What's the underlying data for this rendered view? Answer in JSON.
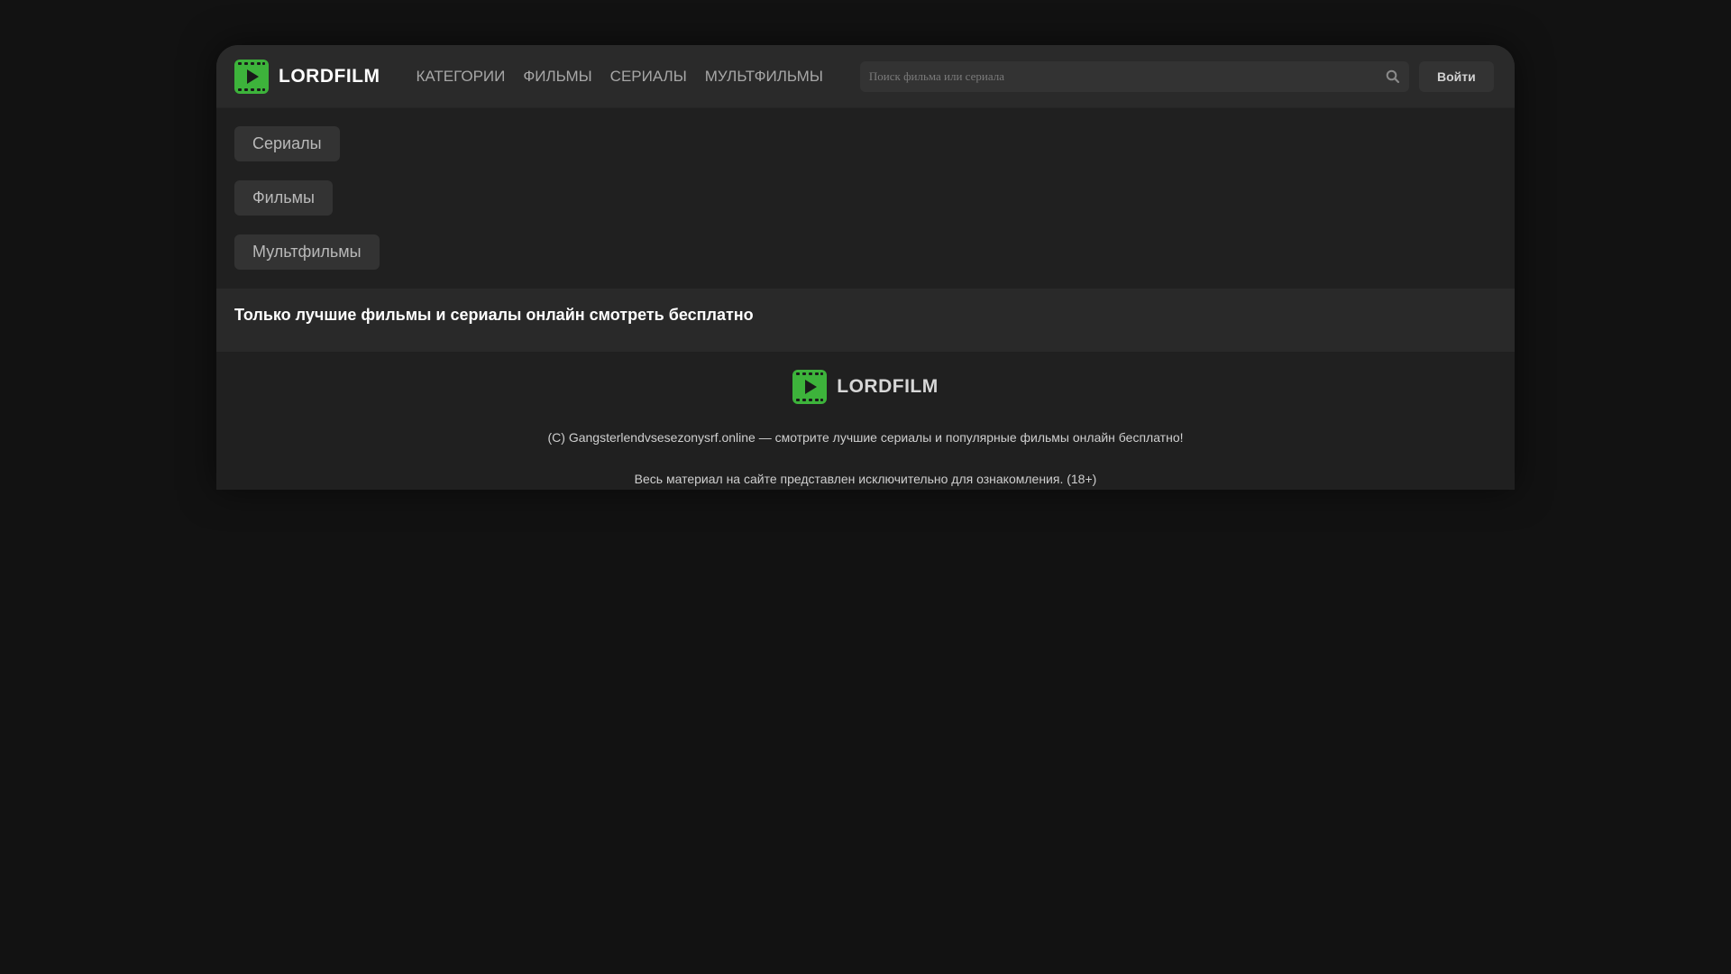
{
  "header": {
    "logo_text": "LORDFILM",
    "nav": [
      "КАТЕГОРИИ",
      "ФИЛЬМЫ",
      "СЕРИАЛЫ",
      "МУЛЬТФИЛЬМЫ"
    ],
    "search_placeholder": "Поиск фильма или сериала",
    "login_label": "Войти"
  },
  "categories": [
    "Сериалы",
    "Фильмы",
    "Мультфильмы"
  ],
  "tagline": "Только лучшие фильмы и сериалы онлайн смотреть бесплатно",
  "footer": {
    "logo_text": "LORDFILM",
    "copyright": "(C) Gangsterlendvsesezonysrf.online — смотрите лучшие сериалы и популярные фильмы онлайн бесплатно!",
    "disclaimer": "Весь материал на сайте представлен исключительно для ознакомления. (18+)"
  },
  "colors": {
    "background": "#121212",
    "panel": "#202020",
    "header": "#2a2a2a",
    "button": "#333333",
    "logo_green": "#3db33b"
  },
  "icons": [
    "film-play-icon",
    "search-icon"
  ]
}
